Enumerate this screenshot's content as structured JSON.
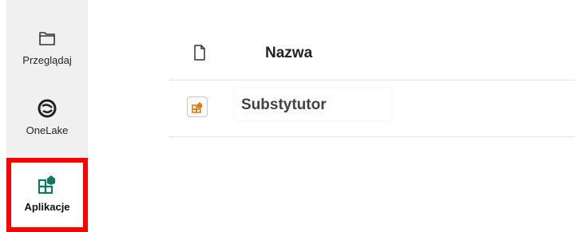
{
  "rail": {
    "items": [
      {
        "label": "Przeglądaj",
        "icon": "folder-icon",
        "active": false
      },
      {
        "label": "OneLake",
        "icon": "onelake-icon",
        "active": false
      },
      {
        "label": "Aplikacje",
        "icon": "apps-icon",
        "active": true
      }
    ],
    "highlight_color": "#ff0000"
  },
  "table": {
    "header": {
      "icon": "file-icon",
      "name_label": "Nazwa"
    },
    "rows": [
      {
        "icon": "app-item-icon",
        "name": "Substytutor"
      }
    ]
  },
  "colors": {
    "rail_bg": "#f0f0f0",
    "accent_green": "#117865",
    "app_icon_orange": "#e07b1a"
  }
}
